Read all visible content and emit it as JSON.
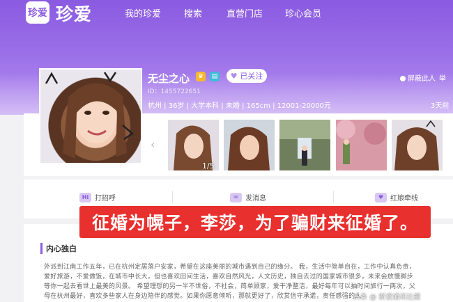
{
  "header": {
    "logo_mark": "珍爱",
    "logo_text": "珍爱",
    "nav": [
      "我的珍爱",
      "搜索",
      "直营门店",
      "珍心会员"
    ]
  },
  "profile": {
    "name": "无尘之心",
    "id": "ID：1455722651",
    "follow_label": "已关注",
    "attributes": "杭州 | 36岁 | 大学本科 | 未婚 | 165cm | 12001-20000元",
    "block_label": "屏蔽此人",
    "report_label": "举",
    "visits_label": "3天前"
  },
  "photos": {
    "counter": "1/5",
    "arrow": "‹"
  },
  "actions": [
    {
      "icon": "Hi",
      "label": "打招呼"
    },
    {
      "icon": "✉",
      "label": "发消息"
    },
    {
      "icon": "♥",
      "label": "红娘牵线"
    }
  ],
  "caption": "征婚为幌子，李莎，为了骗财来征婚了。",
  "monologue": {
    "title": "内心独白",
    "lines": [
      "外派到江南工作五年，已在杭州定居落户安家，希望在这座美丽的城市遇到自己的缘分。 我，生活中简单自在，工作中认真负责，",
      "爱好旅游，不爱做饭，在城市中长大，但也喜欢田间生活，喜欢自然风光，人文历史，独自去过的国家城市很多，未来会放慢脚步",
      "等你一起去看世上最美的风景。 希望理想的另一半不世俗，不社会，简单顾家，爱干净整洁，最好每年可以抽时间旅行一两次，父",
      "母在杭州最好，喜欢多些家人在身边陪伴的感觉。如果你愿意倾听，那就更好了，欣赏信守承诺，责任感强的人"
    ]
  },
  "watermark": "头条 @ 新瓷通讯社报"
}
